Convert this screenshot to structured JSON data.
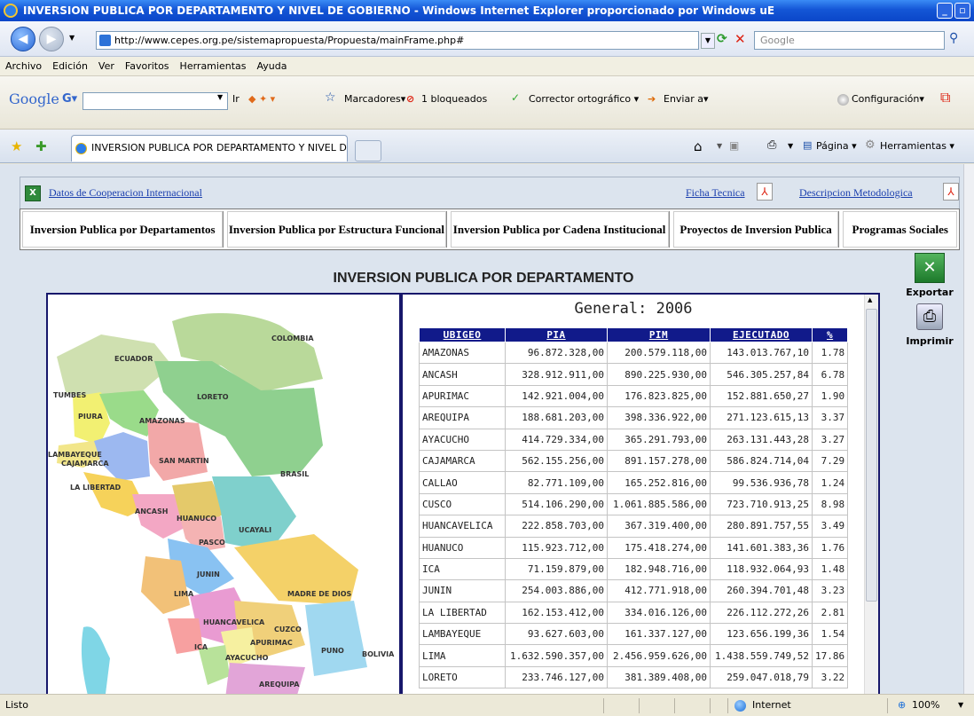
{
  "window": {
    "title": "INVERSION PUBLICA POR DEPARTAMENTO Y NIVEL DE GOBIERNO - Windows Internet Explorer proporcionado por Windows uE"
  },
  "address": {
    "url": "http://www.cepes.org.pe/sistemapropuesta/Propuesta/mainFrame.php#",
    "search_placeholder": "Google"
  },
  "menu": [
    "Archivo",
    "Edición",
    "Ver",
    "Favoritos",
    "Herramientas",
    "Ayuda"
  ],
  "google_toolbar": {
    "logo": "Google",
    "go_label": "Ir",
    "bookmarks": "Marcadores",
    "blocked": "1 bloqueados",
    "spellcheck": "Corrector ortográfico",
    "send": "Enviar a",
    "settings": "Configuración"
  },
  "tabbar": {
    "tab_label": "INVERSION PUBLICA POR DEPARTAMENTO Y NIVEL D...",
    "page_label": "Página",
    "tools_label": "Herramientas"
  },
  "page": {
    "coop_link": "Datos de Cooperacion Internacional",
    "ficha_link": "Ficha Tecnica",
    "desc_link": "Descripcion Metodologica",
    "nav": [
      "Inversion Publica por Departamentos",
      "Inversion Publica por Estructura Funcional",
      "Inversion Publica por Cadena Institucional",
      "Proyectos de Inversion Publica",
      "Programas Sociales"
    ],
    "title": "INVERSION PUBLICA POR DEPARTAMENTO",
    "general": "General: 2006",
    "export_label": "Exportar",
    "print_label": "Imprimir",
    "map_labels": {
      "colombia": "COLOMBIA",
      "ecuador": "ECUADOR",
      "tumbes": "TUMBES",
      "loreto": "LORETO",
      "piura": "PIURA",
      "amazonas": "AMAZONAS",
      "lambayeque": "LAMBAYEQUE",
      "cajamarca": "CAJAMARCA",
      "san_martin": "SAN MARTIN",
      "brasil": "BRASIL",
      "la_libertad": "LA LIBERTAD",
      "ancash": "ANCASH",
      "huanuco": "HUANUCO",
      "ucayali": "UCAYALI",
      "pasco": "PASCO",
      "junin": "JUNIN",
      "lima": "LIMA",
      "madre_de_dios": "MADRE DE DIOS",
      "huancavelica": "HUANCAVELICA",
      "cuzco": "CUZCO",
      "ica": "ICA",
      "apurimac": "APURIMAC",
      "ayacucho": "AYACUCHO",
      "puno": "PUNO",
      "bolivia": "BOLIVIA",
      "arequipa": "AREQUIPA"
    }
  },
  "table": {
    "headers": [
      "UBIGEO",
      "PIA",
      "PIM",
      "EJECUTADO",
      "%"
    ],
    "rows": [
      [
        "AMAZONAS",
        "96.872.328,00",
        "200.579.118,00",
        "143.013.767,10",
        "1.78"
      ],
      [
        "ANCASH",
        "328.912.911,00",
        "890.225.930,00",
        "546.305.257,84",
        "6.78"
      ],
      [
        "APURIMAC",
        "142.921.004,00",
        "176.823.825,00",
        "152.881.650,27",
        "1.90"
      ],
      [
        "AREQUIPA",
        "188.681.203,00",
        "398.336.922,00",
        "271.123.615,13",
        "3.37"
      ],
      [
        "AYACUCHO",
        "414.729.334,00",
        "365.291.793,00",
        "263.131.443,28",
        "3.27"
      ],
      [
        "CAJAMARCA",
        "562.155.256,00",
        "891.157.278,00",
        "586.824.714,04",
        "7.29"
      ],
      [
        "CALLAO",
        "82.771.109,00",
        "165.252.816,00",
        "99.536.936,78",
        "1.24"
      ],
      [
        "CUSCO",
        "514.106.290,00",
        "1.061.885.586,00",
        "723.710.913,25",
        "8.98"
      ],
      [
        "HUANCAVELICA",
        "222.858.703,00",
        "367.319.400,00",
        "280.891.757,55",
        "3.49"
      ],
      [
        "HUANUCO",
        "115.923.712,00",
        "175.418.274,00",
        "141.601.383,36",
        "1.76"
      ],
      [
        "ICA",
        "71.159.879,00",
        "182.948.716,00",
        "118.932.064,93",
        "1.48"
      ],
      [
        "JUNIN",
        "254.003.886,00",
        "412.771.918,00",
        "260.394.701,48",
        "3.23"
      ],
      [
        "LA LIBERTAD",
        "162.153.412,00",
        "334.016.126,00",
        "226.112.272,26",
        "2.81"
      ],
      [
        "LAMBAYEQUE",
        "93.627.603,00",
        "161.337.127,00",
        "123.656.199,36",
        "1.54"
      ],
      [
        "LIMA",
        "1.632.590.357,00",
        "2.456.959.626,00",
        "1.438.559.749,52",
        "17.86"
      ],
      [
        "LORETO",
        "233.746.127,00",
        "381.389.408,00",
        "259.047.018,79",
        "3.22"
      ]
    ]
  },
  "status": {
    "left": "Listo",
    "zone": "Internet",
    "zoom": "100%"
  }
}
